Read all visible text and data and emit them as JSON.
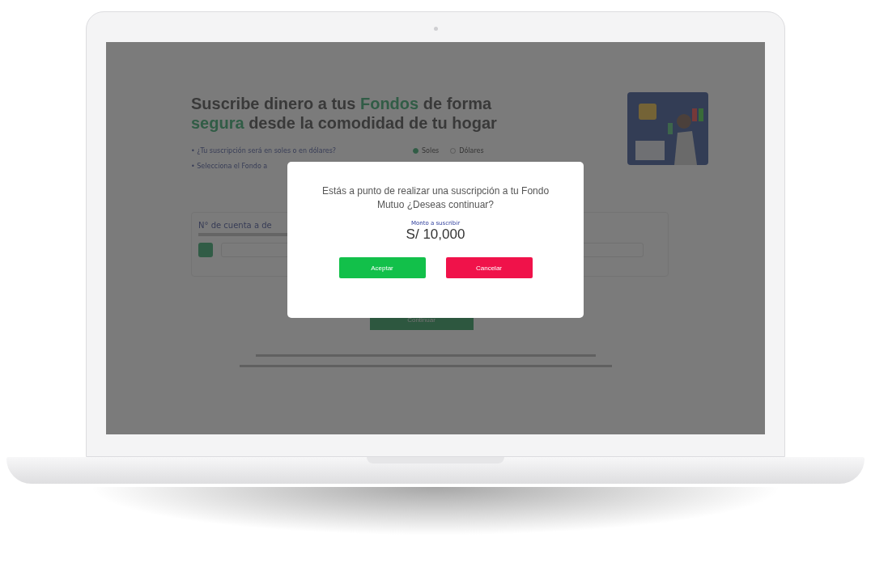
{
  "page": {
    "heading": "Suscribe dinero a tus **Fondos** de forma **segura** desde la comodidad de tu hogar",
    "questions": [
      {
        "text": "• ¿Tu suscripción será en soles o en dólares?",
        "options": [
          {
            "label": "Soles",
            "selected": true
          },
          {
            "label": "Dólares",
            "selected": false
          }
        ]
      },
      {
        "text": "• Selecciona el Fondo a"
      }
    ],
    "account": {
      "label": "N° de cuenta a de"
    },
    "continue_button": "Continuar"
  },
  "dialog": {
    "message": "Estás a punto de realizar una suscripción a tu Fondo Mutuo ¿Deseas continuar?",
    "amount_label": "Monto a suscribir",
    "amount": "S/ 10,000",
    "buttons": [
      {
        "label": "Aceptar",
        "kind": "confirm"
      },
      {
        "label": "Cancelar",
        "kind": "cancel"
      }
    ]
  }
}
